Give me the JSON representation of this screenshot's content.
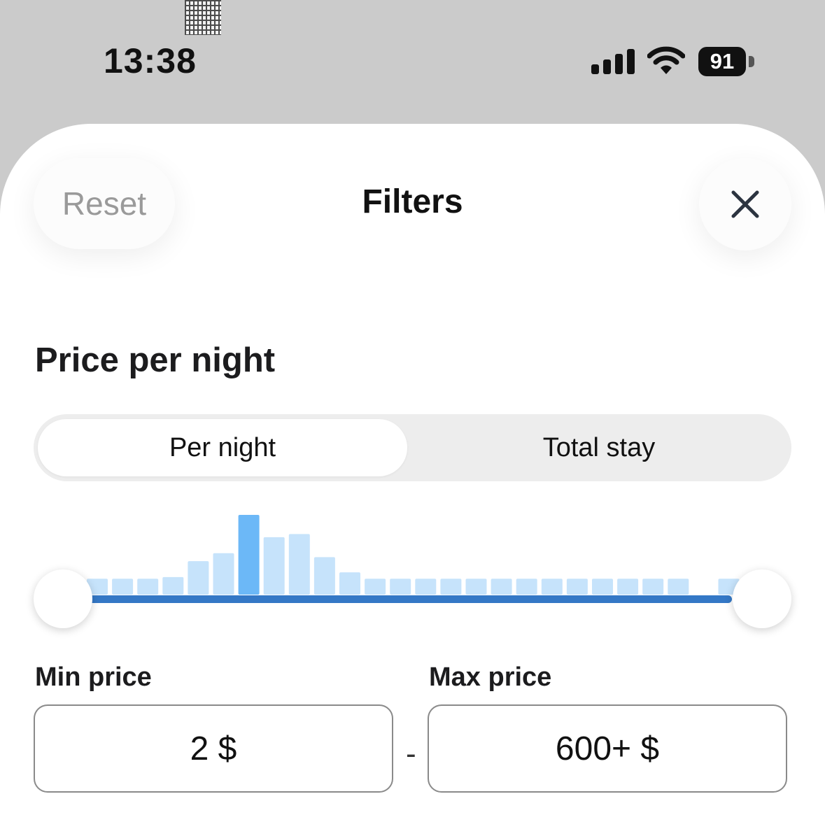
{
  "status_bar": {
    "time": "13:38",
    "battery": "91"
  },
  "header": {
    "reset_label": "Reset",
    "title": "Filters"
  },
  "section": {
    "title": "Price per night"
  },
  "toggle": {
    "options": [
      "Per night",
      "Total stay"
    ],
    "selected": "Per night"
  },
  "histogram": {
    "bar_color": "#c6e3fb",
    "highlight_color": "#6cb8f7",
    "values": [
      0.2,
      0.2,
      0.2,
      0.22,
      0.42,
      0.52,
      1.0,
      0.72,
      0.76,
      0.47,
      0.28,
      0.2,
      0.2,
      0.2,
      0.2,
      0.2,
      0.2,
      0.2,
      0.2,
      0.2,
      0.2,
      0.2,
      0.2,
      0.2,
      0.0,
      0.2,
      0.2
    ],
    "highlight_index": 6
  },
  "price_range": {
    "min_label": "Min price",
    "max_label": "Max price",
    "min_value": "2 $",
    "max_value": "600+ $",
    "separator": "-",
    "track_color": "#3478c6"
  }
}
